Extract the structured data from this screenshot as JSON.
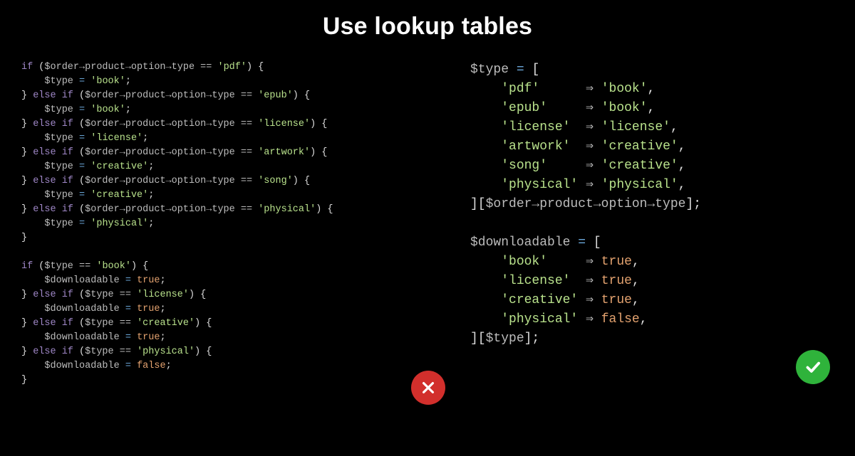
{
  "title": "Use lookup tables",
  "colors": {
    "keyword": "#9f87c7",
    "string": "#b9e28c",
    "boolean": "#e3a26f",
    "punctuation": "#bcbcbc",
    "bad_badge": "#d22f2c",
    "good_badge": "#2fb33b"
  },
  "left_code": {
    "block1": {
      "chain": "$order→product→option→type",
      "assign_var": "$type",
      "branches": [
        {
          "cmp": "'pdf'",
          "val": "'book'"
        },
        {
          "cmp": "'epub'",
          "val": "'book'"
        },
        {
          "cmp": "'license'",
          "val": "'license'"
        },
        {
          "cmp": "'artwork'",
          "val": "'creative'"
        },
        {
          "cmp": "'song'",
          "val": "'creative'"
        },
        {
          "cmp": "'physical'",
          "val": "'physical'"
        }
      ]
    },
    "block2": {
      "chain": "$type",
      "assign_var": "$downloadable",
      "branches": [
        {
          "cmp": "'book'",
          "val": "true"
        },
        {
          "cmp": "'license'",
          "val": "true"
        },
        {
          "cmp": "'creative'",
          "val": "true"
        },
        {
          "cmp": "'physical'",
          "val": "false"
        }
      ]
    }
  },
  "right_code": {
    "block1": {
      "assign_var": "$type",
      "entries": [
        {
          "k": "'pdf'",
          "v": "'book'"
        },
        {
          "k": "'epub'",
          "v": "'book'"
        },
        {
          "k": "'license'",
          "v": "'license'"
        },
        {
          "k": "'artwork'",
          "v": "'creative'"
        },
        {
          "k": "'song'",
          "v": "'creative'"
        },
        {
          "k": "'physical'",
          "v": "'physical'"
        }
      ],
      "index": "$order→product→option→type"
    },
    "block2": {
      "assign_var": "$downloadable",
      "entries": [
        {
          "k": "'book'",
          "v": "true"
        },
        {
          "k": "'license'",
          "v": "true"
        },
        {
          "k": "'creative'",
          "v": "true"
        },
        {
          "k": "'physical'",
          "v": "false"
        }
      ],
      "index": "$type"
    }
  },
  "badges": {
    "bad": "cross-icon",
    "good": "check-icon"
  }
}
